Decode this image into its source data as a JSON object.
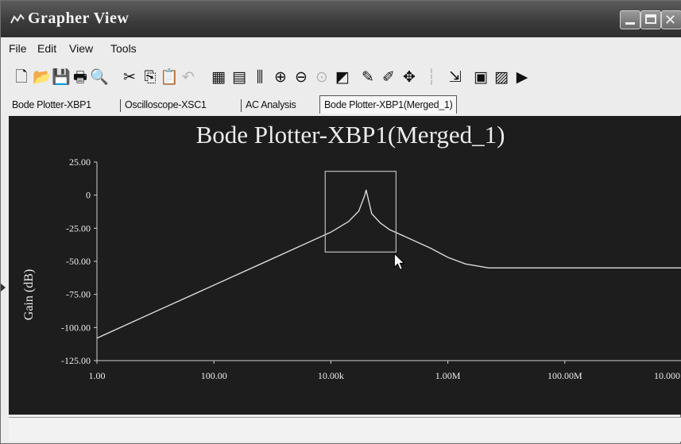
{
  "window": {
    "title": "Grapher View"
  },
  "menu": {
    "file": "File",
    "edit": "Edit",
    "view": "View",
    "tools": "Tools"
  },
  "toolbar": {
    "icons": [
      "new-icon",
      "open-icon",
      "save-icon",
      "print-icon",
      "print-preview-icon",
      "cut-icon",
      "copy-icon",
      "paste-icon",
      "undo-icon",
      "grid-icon",
      "legend-icon",
      "cursors-icon",
      "zoom-in-icon",
      "zoom-out-icon",
      "zoom-area-icon",
      "overlay-icon",
      "select-marks-icon",
      "properties-icon",
      "reverse-colors-icon",
      "bar-icon",
      "export-icon",
      "excel-icon",
      "mathcad-icon",
      "expand-icon"
    ]
  },
  "tabs": [
    {
      "label": "Bode Plotter-XBP1",
      "active": false
    },
    {
      "label": "Oscilloscope-XSC1",
      "active": false
    },
    {
      "label": "AC Analysis",
      "active": false
    },
    {
      "label": "Bode Plotter-XBP1(Merged_1)",
      "active": true
    }
  ],
  "chart_data": {
    "type": "line",
    "title": "Bode Plotter-XBP1(Merged_1)",
    "xlabel": "",
    "ylabel": "Gain (dB)",
    "xscale": "log",
    "xlim": [
      1,
      10000000000
    ],
    "ylim": [
      -125,
      25
    ],
    "x_tick_labels": [
      "1.00",
      "100.00",
      "10.00k",
      "1.00M",
      "100.00M",
      "10.000"
    ],
    "y_tick_labels": [
      "25.00",
      "0",
      "-25.00",
      "-50.00",
      "-75.00",
      "-100.00",
      "-125.00"
    ],
    "grid": false,
    "series": [
      {
        "x": [
          1,
          10,
          100,
          1000,
          10000,
          20000,
          30000,
          38000,
          40000,
          42000,
          50000,
          70000,
          100000,
          200000,
          500000,
          1000000,
          2000000,
          5000000,
          10000000,
          50000000,
          1000000000,
          10000000000
        ],
        "y": [
          -108,
          -88,
          -68,
          -48,
          -28,
          -20,
          -12,
          0,
          4,
          0,
          -14,
          -21,
          -26,
          -32,
          -40,
          -47,
          -52,
          -55,
          -55,
          -55,
          -55,
          -55
        ]
      }
    ],
    "zoom_box": {
      "x_from": 8000,
      "x_to": 130000,
      "y_from": -43,
      "y_to": 18
    }
  },
  "colors": {
    "plot_bg": "#1d1d1d",
    "trace": "#d9d9d9",
    "zoom_box": "#bdbdbd"
  }
}
